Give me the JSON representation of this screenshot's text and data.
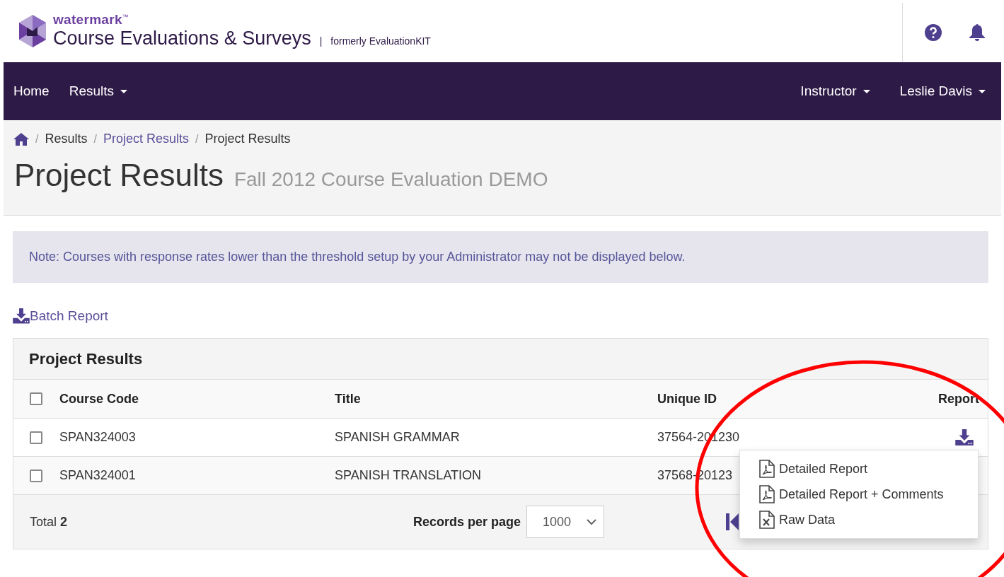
{
  "header": {
    "brand": "watermark",
    "trademark": "™",
    "product": "Course Evaluations & Surveys",
    "separator": "|",
    "tagline": "formerly EvaluationKIT"
  },
  "nav": {
    "left": [
      {
        "label": "Home",
        "dropdown": false
      },
      {
        "label": "Results",
        "dropdown": true
      }
    ],
    "right": [
      {
        "label": "Instructor",
        "dropdown": true
      },
      {
        "label": "Leslie Davis",
        "dropdown": true
      }
    ]
  },
  "breadcrumb": {
    "separator": "/",
    "items": [
      {
        "label": "Results",
        "link": false
      },
      {
        "label": "Project Results",
        "link": true
      },
      {
        "label": "Project Results",
        "link": false
      }
    ]
  },
  "page_title": "Project Results",
  "page_subtitle": "Fall 2012 Course Evaluation DEMO",
  "note": "Note: Courses with response rates lower than the threshold setup by your Administrator may not be displayed below.",
  "batch_report": "Batch Report",
  "panel": {
    "title": "Project Results",
    "select_all": {
      "checked": false
    },
    "columns": [
      "Course Code",
      "Title",
      "Unique ID",
      "Report"
    ],
    "rows": [
      {
        "checked": false,
        "course_code": "SPAN324003",
        "title": "SPANISH GRAMMAR",
        "unique_id": "37564-201230",
        "report_button": true
      },
      {
        "checked": false,
        "course_code": "SPAN324001",
        "title": "SPANISH TRANSLATION",
        "unique_id": "37568-20123",
        "report_button": false
      }
    ],
    "footer": {
      "total": "Total **2**",
      "records_label": "Records per page",
      "records_value": "1000"
    }
  },
  "report_menu": {
    "open": true,
    "items": [
      {
        "kind": "pdf",
        "label": "Detailed Report"
      },
      {
        "kind": "pdf",
        "label": "Detailed Report + Comments"
      },
      {
        "kind": "excel",
        "label": "Raw Data"
      }
    ]
  },
  "annotation": {
    "kind": "ellipse"
  }
}
